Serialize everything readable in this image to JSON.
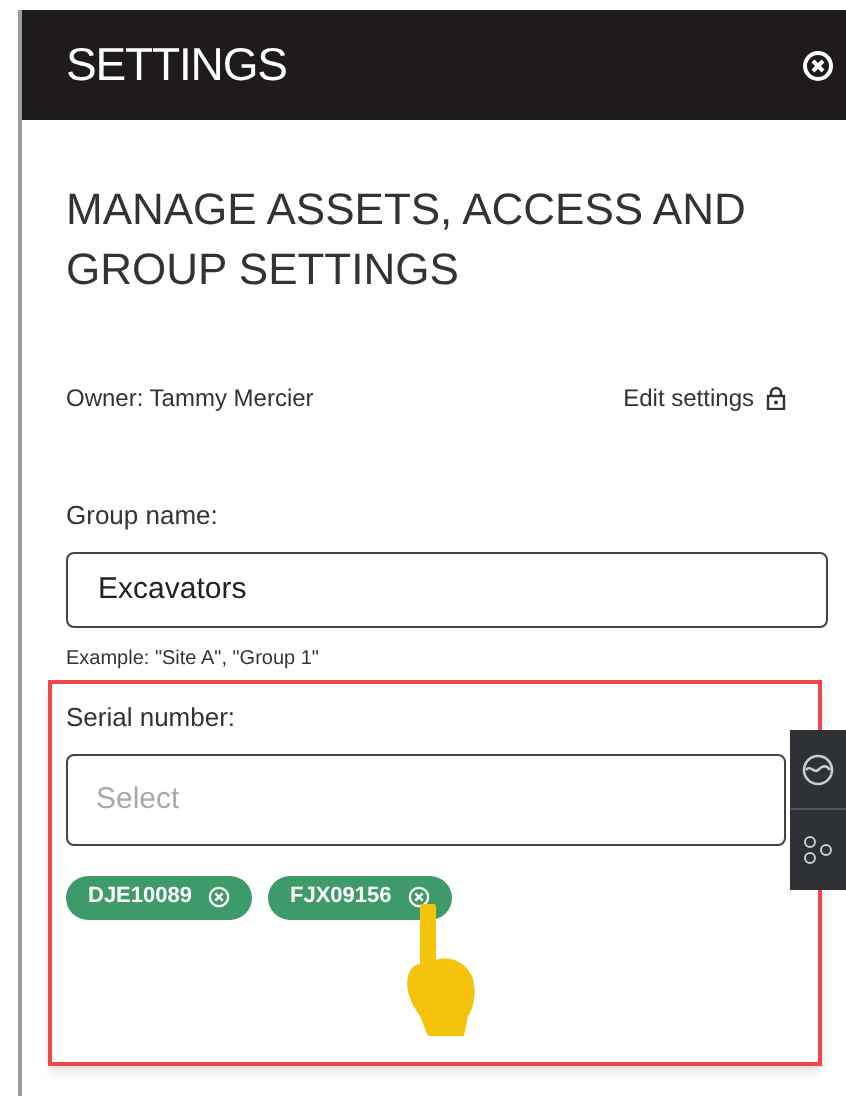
{
  "header": {
    "title": "SETTINGS"
  },
  "heading": "MANAGE ASSETS, ACCESS AND GROUP SETTINGS",
  "owner": "Owner: Tammy Mercier",
  "edit_settings": "Edit settings",
  "group_name": {
    "label": "Group name:",
    "value": "Excavators",
    "hint": "Example: \"Site A\", \"Group 1\""
  },
  "serial_number": {
    "label": "Serial number:",
    "placeholder": "Select",
    "chips": [
      {
        "label": "DJE10089"
      },
      {
        "label": "FJX09156"
      }
    ]
  }
}
